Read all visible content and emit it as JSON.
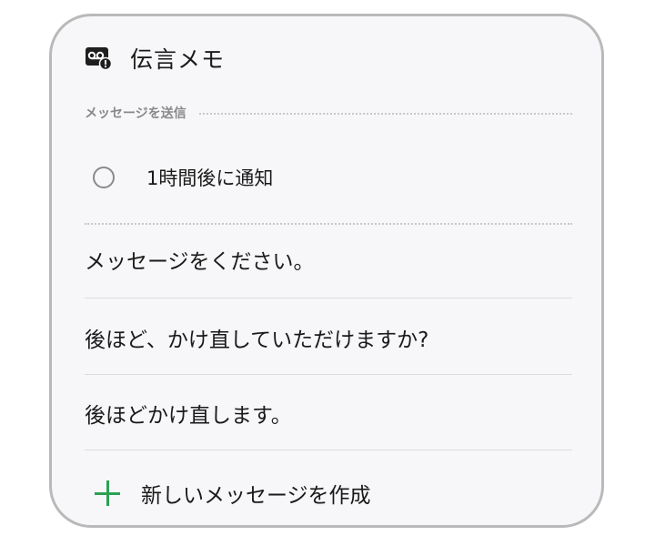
{
  "header": {
    "icon": "voicemail-icon",
    "title": "伝言メモ"
  },
  "section": {
    "label": "メッセージを送信"
  },
  "option": {
    "label": "1時間後に通知",
    "checked": false
  },
  "messages": [
    {
      "text": "メッセージをください。"
    },
    {
      "text": "後ほど、かけ直していただけますか?"
    },
    {
      "text": "後ほどかけ直します。"
    }
  ],
  "create": {
    "icon": "plus-icon",
    "label": "新しいメッセージを作成"
  },
  "colors": {
    "accent_green": "#2aa152",
    "card_background": "#f7f7f9",
    "card_border": "#b9b9b9",
    "secondary_text": "#888888"
  }
}
